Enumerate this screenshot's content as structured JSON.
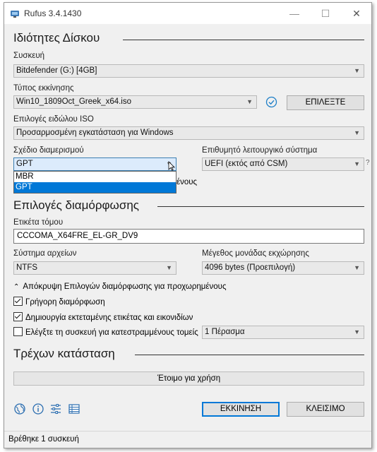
{
  "window": {
    "title": "Rufus 3.4.1430",
    "minimize_glyph": "—",
    "maximize_glyph": "☐",
    "close_glyph": "✕"
  },
  "drive_properties": {
    "heading": "Ιδιότητες Δίσκου",
    "device_label": "Συσκευή",
    "device_value": "Bitdefender (G:) [4GB]",
    "boot_selection_label": "Τύπος εκκίνησης",
    "boot_selection_value": "Win10_1809Oct_Greek_x64.iso",
    "select_button": "ΕΠΙΛΕΞΤΕ",
    "image_option_label": "Επιλογές ειδώλου ISO",
    "image_option_value": "Προσαρμοσμένη εγκατάσταση για Windows",
    "partition_scheme_label": "Σχέδιο διαμερισμού",
    "partition_scheme_value": "GPT",
    "partition_scheme_options": [
      "MBR",
      "GPT"
    ],
    "partition_scheme_selected_index": 1,
    "target_system_label": "Επιθυμητό λειτουργικό σύστημα",
    "target_system_value": "UEFI (εκτός από CSM)",
    "hidden_text_fragment": "ένους"
  },
  "format_options": {
    "heading": "Επιλογές διαμόρφωσης",
    "volume_label_label": "Ετικέτα τόμου",
    "volume_label_value": "CCCOMA_X64FRE_EL-GR_DV9",
    "file_system_label": "Σύστημα αρχείων",
    "file_system_value": "NTFS",
    "cluster_size_label": "Μέγεθος μονάδας εκχώρησης",
    "cluster_size_value": "4096 bytes (Προεπιλογή)",
    "advanced_toggle": "Απόκρυψη Επιλογών διαμόρφωσης για προχωρημένους",
    "quick_format": {
      "label": "Γρήγορη διαμόρφωση",
      "checked": true
    },
    "extended_label": {
      "label": "Δημιουργία εκτεταμένης ετικέτας και εικονιδίων",
      "checked": true
    },
    "bad_blocks": {
      "label": "Ελέγξτε τη συσκευή για κατεστραμμένους τομείς",
      "checked": false
    },
    "passes_value": "1 Πέρασμα"
  },
  "status": {
    "heading": "Τρέχων κατάσταση",
    "progress_text": "Έτοιμο για χρήση",
    "progress_fraction": 0,
    "start_button": "ΕΚΚΙΝΗΣΗ",
    "close_button": "ΚΛΕΙΣΙΜΟ",
    "statusbar_text": "Βρέθηκε 1 συσκευή"
  },
  "colors": {
    "accent": "#0078d7",
    "check_icon": "#1e7fc7",
    "window_bg": "#f0f0f0"
  }
}
